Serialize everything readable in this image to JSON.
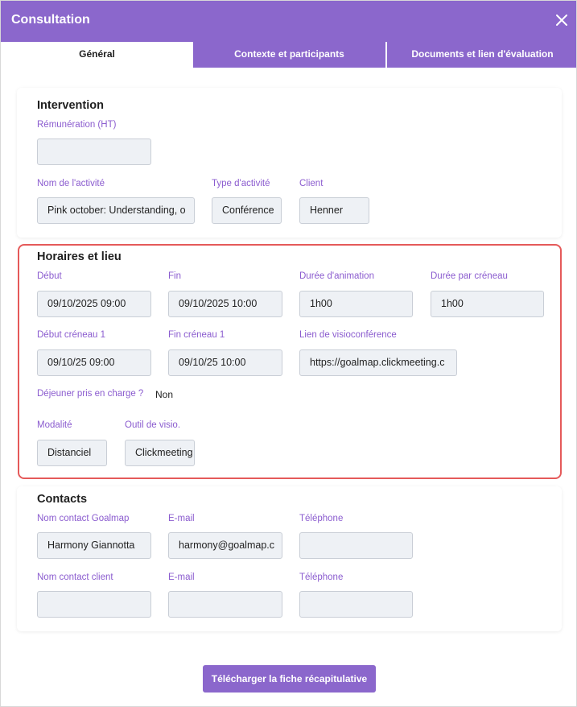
{
  "header": {
    "title": "Consultation"
  },
  "tabs": [
    {
      "label": "Général"
    },
    {
      "label": "Contexte et participants"
    },
    {
      "label": "Documents et lien d'évaluation"
    }
  ],
  "intervention": {
    "title": "Intervention",
    "remuneration_label": "Rémunération (HT)",
    "remuneration_value": "",
    "activity_name_label": "Nom de l'activité",
    "activity_name_value": "Pink october: Understanding, o",
    "activity_type_label": "Type d'activité",
    "activity_type_value": "Conférence",
    "client_label": "Client",
    "client_value": "Henner"
  },
  "horaires": {
    "title": "Horaires et lieu",
    "debut_label": "Début",
    "debut_value": "09/10/2025 09:00",
    "fin_label": "Fin",
    "fin_value": "09/10/2025 10:00",
    "duree_animation_label": "Durée d'animation",
    "duree_animation_value": "1h00",
    "duree_creneau_label": "Durée par créneau",
    "duree_creneau_value": "1h00",
    "debut_creneau_label": "Début créneau 1",
    "debut_creneau_value": "09/10/25 09:00",
    "fin_creneau_label": "Fin créneau 1",
    "fin_creneau_value": "09/10/25 10:00",
    "lien_visio_label": "Lien de visioconférence",
    "lien_visio_value": "https://goalmap.clickmeeting.c",
    "dejeuner_label": "Déjeuner pris en charge ?",
    "dejeuner_value": "Non",
    "modalite_label": "Modalité",
    "modalite_value": "Distanciel",
    "outil_label": "Outil de visio.",
    "outil_value": "Clickmeeting"
  },
  "contacts": {
    "title": "Contacts",
    "goalmap_name_label": "Nom contact Goalmap",
    "goalmap_name_value": "Harmony Giannotta",
    "goalmap_email_label": "E-mail",
    "goalmap_email_value": "harmony@goalmap.c",
    "goalmap_phone_label": "Téléphone",
    "goalmap_phone_value": "",
    "client_name_label": "Nom contact client",
    "client_name_value": "",
    "client_email_label": "E-mail",
    "client_email_value": "",
    "client_phone_label": "Téléphone",
    "client_phone_value": ""
  },
  "download_button": "Télécharger la fiche récapitulative",
  "colors": {
    "accent": "#8b67cc",
    "highlight": "#e55a5a",
    "label": "#8b5ccf"
  }
}
